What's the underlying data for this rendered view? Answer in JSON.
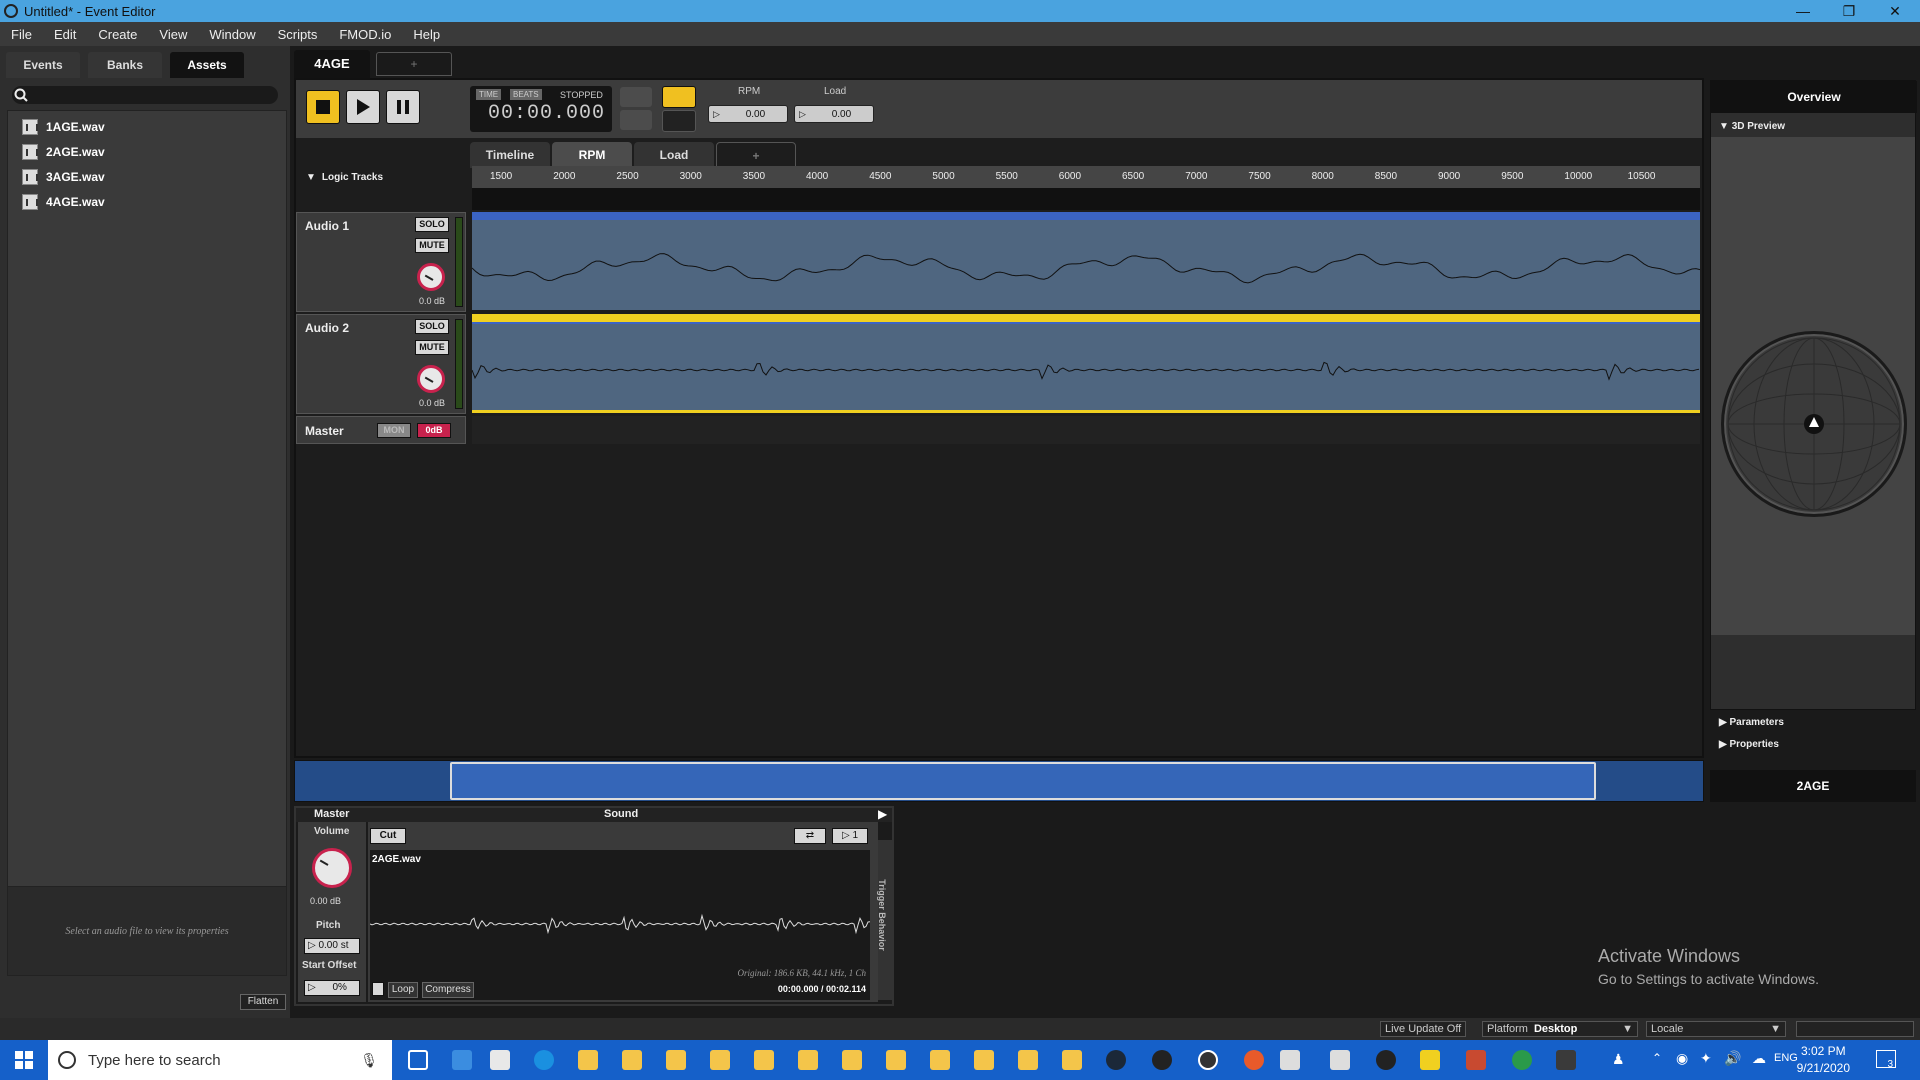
{
  "window": {
    "title": "Untitled* - Event Editor"
  },
  "menu": [
    "File",
    "Edit",
    "Create",
    "View",
    "Window",
    "Scripts",
    "FMOD.io",
    "Help"
  ],
  "left": {
    "tabs": [
      "Events",
      "Banks",
      "Assets"
    ],
    "active_tab": "Assets",
    "assets": [
      "1AGE.wav",
      "2AGE.wav",
      "3AGE.wav",
      "4AGE.wav"
    ],
    "prop_hint": "Select an audio file to view its properties",
    "flatten": "Flatten"
  },
  "event": {
    "tab": "4AGE",
    "add_tab": "+",
    "transport": {
      "time_label": "TIME",
      "beats_label": "BEATS",
      "state": "STOPPED",
      "time": "00:00.000"
    },
    "params": [
      {
        "label": "RPM",
        "value": "0.00"
      },
      {
        "label": "Load",
        "value": "0.00"
      }
    ],
    "param_tabs": [
      "Timeline",
      "RPM",
      "Load",
      "+"
    ],
    "active_param_tab": "RPM",
    "logic_tracks": "Logic Tracks",
    "ruler": [
      "1500",
      "2000",
      "2500",
      "3000",
      "3500",
      "4000",
      "4500",
      "5000",
      "5500",
      "6000",
      "6500",
      "7000",
      "7500",
      "8000",
      "8500",
      "9000",
      "9500",
      "10000",
      "10500"
    ],
    "tracks": [
      {
        "name": "Audio 1",
        "solo": "SOLO",
        "mute": "MUTE",
        "db": "0.0 dB"
      },
      {
        "name": "Audio 2",
        "solo": "SOLO",
        "mute": "MUTE",
        "db": "0.0 dB"
      }
    ],
    "master": {
      "name": "Master",
      "mon": "MON",
      "level": "0dB"
    }
  },
  "overview": {
    "title": "Overview",
    "preview3d": "3D Preview",
    "parameters": "Parameters",
    "properties": "Properties",
    "selected": "2AGE"
  },
  "editor": {
    "master_title": "Master",
    "sound_title": "Sound",
    "volume": "Volume",
    "volume_db": "0.00 dB",
    "pitch": "Pitch",
    "pitch_value": "0.00 st",
    "start_offset": "Start Offset",
    "offset_value": "0%",
    "cut": "Cut",
    "loop_count": "1",
    "file": "2AGE.wav",
    "original": "Original: 186.6 KB, 44.1 kHz, 1 Ch",
    "position": "00:00.000 / 00:02.114",
    "loop": "Loop",
    "compress": "Compress",
    "trigger": "Trigger Behavior"
  },
  "watermark": {
    "line1": "Activate Windows",
    "line2": "Go to Settings to activate Windows."
  },
  "status": {
    "live_update": "Live Update Off",
    "platform_label": "Platform",
    "platform": "Desktop",
    "locale_label": "Locale"
  },
  "taskbar": {
    "search_placeholder": "Type here to search",
    "lang": "ENG",
    "time": "3:02 PM",
    "date": "9/21/2020",
    "notif": "3"
  }
}
